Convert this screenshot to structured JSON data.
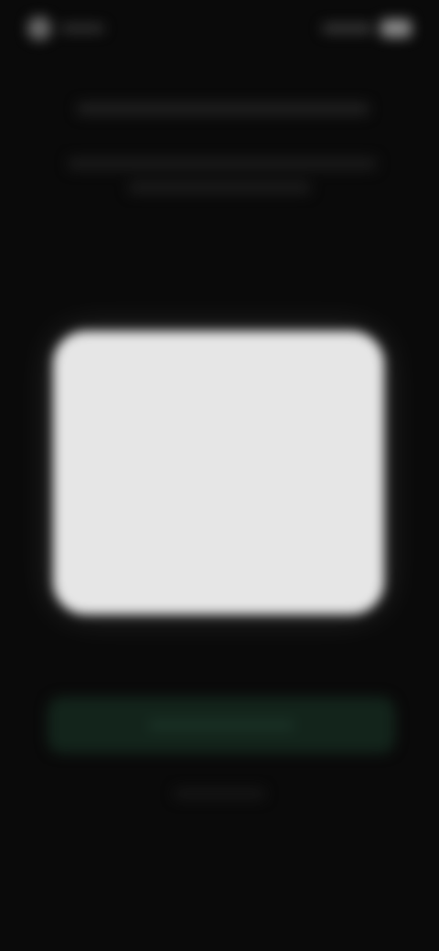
{
  "status_bar": {
    "time": "",
    "battery_icon": "battery-icon",
    "signal_icon": "signal-icon"
  },
  "background": {
    "heading": "",
    "subtitle": "",
    "primary_button_label": "",
    "footer_text": ""
  },
  "dialog": {
    "title": "",
    "body": "",
    "left_button_label": "",
    "right_button_label": ""
  },
  "colors": {
    "background": "#0a0a0a",
    "dialog": "#e6e6e6",
    "primary_button": "#13241b"
  }
}
